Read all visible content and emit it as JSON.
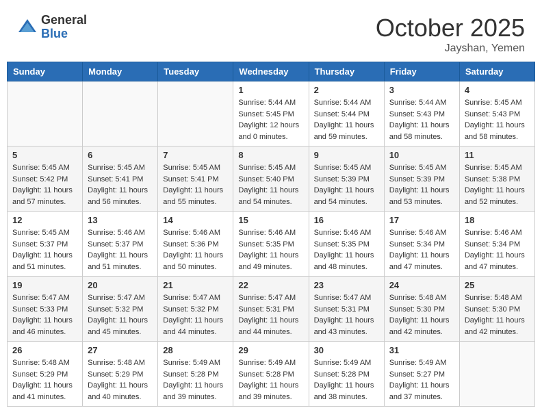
{
  "header": {
    "logo_general": "General",
    "logo_blue": "Blue",
    "month_title": "October 2025",
    "location": "Jayshan, Yemen"
  },
  "days_of_week": [
    "Sunday",
    "Monday",
    "Tuesday",
    "Wednesday",
    "Thursday",
    "Friday",
    "Saturday"
  ],
  "weeks": [
    [
      {
        "day": "",
        "info": ""
      },
      {
        "day": "",
        "info": ""
      },
      {
        "day": "",
        "info": ""
      },
      {
        "day": "1",
        "info": "Sunrise: 5:44 AM\nSunset: 5:45 PM\nDaylight: 12 hours and 0 minutes."
      },
      {
        "day": "2",
        "info": "Sunrise: 5:44 AM\nSunset: 5:44 PM\nDaylight: 11 hours and 59 minutes."
      },
      {
        "day": "3",
        "info": "Sunrise: 5:44 AM\nSunset: 5:43 PM\nDaylight: 11 hours and 58 minutes."
      },
      {
        "day": "4",
        "info": "Sunrise: 5:45 AM\nSunset: 5:43 PM\nDaylight: 11 hours and 58 minutes."
      }
    ],
    [
      {
        "day": "5",
        "info": "Sunrise: 5:45 AM\nSunset: 5:42 PM\nDaylight: 11 hours and 57 minutes."
      },
      {
        "day": "6",
        "info": "Sunrise: 5:45 AM\nSunset: 5:41 PM\nDaylight: 11 hours and 56 minutes."
      },
      {
        "day": "7",
        "info": "Sunrise: 5:45 AM\nSunset: 5:41 PM\nDaylight: 11 hours and 55 minutes."
      },
      {
        "day": "8",
        "info": "Sunrise: 5:45 AM\nSunset: 5:40 PM\nDaylight: 11 hours and 54 minutes."
      },
      {
        "day": "9",
        "info": "Sunrise: 5:45 AM\nSunset: 5:39 PM\nDaylight: 11 hours and 54 minutes."
      },
      {
        "day": "10",
        "info": "Sunrise: 5:45 AM\nSunset: 5:39 PM\nDaylight: 11 hours and 53 minutes."
      },
      {
        "day": "11",
        "info": "Sunrise: 5:45 AM\nSunset: 5:38 PM\nDaylight: 11 hours and 52 minutes."
      }
    ],
    [
      {
        "day": "12",
        "info": "Sunrise: 5:45 AM\nSunset: 5:37 PM\nDaylight: 11 hours and 51 minutes."
      },
      {
        "day": "13",
        "info": "Sunrise: 5:46 AM\nSunset: 5:37 PM\nDaylight: 11 hours and 51 minutes."
      },
      {
        "day": "14",
        "info": "Sunrise: 5:46 AM\nSunset: 5:36 PM\nDaylight: 11 hours and 50 minutes."
      },
      {
        "day": "15",
        "info": "Sunrise: 5:46 AM\nSunset: 5:35 PM\nDaylight: 11 hours and 49 minutes."
      },
      {
        "day": "16",
        "info": "Sunrise: 5:46 AM\nSunset: 5:35 PM\nDaylight: 11 hours and 48 minutes."
      },
      {
        "day": "17",
        "info": "Sunrise: 5:46 AM\nSunset: 5:34 PM\nDaylight: 11 hours and 47 minutes."
      },
      {
        "day": "18",
        "info": "Sunrise: 5:46 AM\nSunset: 5:34 PM\nDaylight: 11 hours and 47 minutes."
      }
    ],
    [
      {
        "day": "19",
        "info": "Sunrise: 5:47 AM\nSunset: 5:33 PM\nDaylight: 11 hours and 46 minutes."
      },
      {
        "day": "20",
        "info": "Sunrise: 5:47 AM\nSunset: 5:32 PM\nDaylight: 11 hours and 45 minutes."
      },
      {
        "day": "21",
        "info": "Sunrise: 5:47 AM\nSunset: 5:32 PM\nDaylight: 11 hours and 44 minutes."
      },
      {
        "day": "22",
        "info": "Sunrise: 5:47 AM\nSunset: 5:31 PM\nDaylight: 11 hours and 44 minutes."
      },
      {
        "day": "23",
        "info": "Sunrise: 5:47 AM\nSunset: 5:31 PM\nDaylight: 11 hours and 43 minutes."
      },
      {
        "day": "24",
        "info": "Sunrise: 5:48 AM\nSunset: 5:30 PM\nDaylight: 11 hours and 42 minutes."
      },
      {
        "day": "25",
        "info": "Sunrise: 5:48 AM\nSunset: 5:30 PM\nDaylight: 11 hours and 42 minutes."
      }
    ],
    [
      {
        "day": "26",
        "info": "Sunrise: 5:48 AM\nSunset: 5:29 PM\nDaylight: 11 hours and 41 minutes."
      },
      {
        "day": "27",
        "info": "Sunrise: 5:48 AM\nSunset: 5:29 PM\nDaylight: 11 hours and 40 minutes."
      },
      {
        "day": "28",
        "info": "Sunrise: 5:49 AM\nSunset: 5:28 PM\nDaylight: 11 hours and 39 minutes."
      },
      {
        "day": "29",
        "info": "Sunrise: 5:49 AM\nSunset: 5:28 PM\nDaylight: 11 hours and 39 minutes."
      },
      {
        "day": "30",
        "info": "Sunrise: 5:49 AM\nSunset: 5:28 PM\nDaylight: 11 hours and 38 minutes."
      },
      {
        "day": "31",
        "info": "Sunrise: 5:49 AM\nSunset: 5:27 PM\nDaylight: 11 hours and 37 minutes."
      },
      {
        "day": "",
        "info": ""
      }
    ]
  ]
}
